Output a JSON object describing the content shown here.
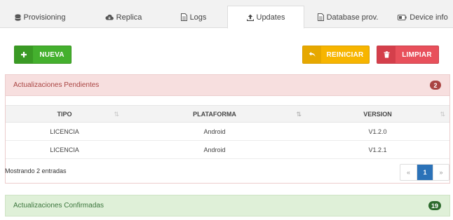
{
  "tabs": [
    {
      "label": "Provisioning",
      "icon": "database-icon"
    },
    {
      "label": "Replica",
      "icon": "cloud-icon"
    },
    {
      "label": "Logs",
      "icon": "file-icon"
    },
    {
      "label": "Updates",
      "icon": "upload-icon",
      "active": true
    },
    {
      "label": "Database prov.",
      "icon": "file-icon"
    },
    {
      "label": "Device info",
      "icon": "battery-icon"
    }
  ],
  "toolbar": {
    "nueva_label": "NUEVA",
    "reiniciar_label": "REINICIAR",
    "limpiar_label": "LIMPIAR"
  },
  "pending": {
    "title": "Actualizaciones Pendientes",
    "count": "2",
    "columns": [
      "TIPO",
      "PLATAFORMA",
      "VERSION"
    ],
    "rows": [
      [
        "LICENCIA",
        "Android",
        "V1.2.0"
      ],
      [
        "LICENCIA",
        "Android",
        "V1.2.1"
      ]
    ],
    "info": "Mostrando 2 entradas",
    "pager": {
      "prev": "«",
      "page": "1",
      "next": "»"
    }
  },
  "confirmed": {
    "title": "Actualizaciones Confirmadas",
    "count": "19"
  },
  "colors": {
    "green": "#44b02e",
    "yellow": "#f7b500",
    "red": "#e8505b",
    "blue": "#2b72b8"
  }
}
